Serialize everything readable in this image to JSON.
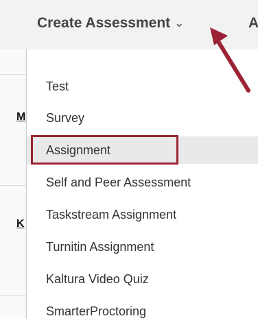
{
  "toolbar": {
    "create_assessment_label": "Create Assessment",
    "next_item_fragment": "A"
  },
  "left_fragments": [
    "M",
    "K"
  ],
  "menu": {
    "items": [
      {
        "label": "Test"
      },
      {
        "label": "Survey"
      },
      {
        "label": "Assignment",
        "highlighted": true
      },
      {
        "label": "Self and Peer Assessment"
      },
      {
        "label": "Taskstream Assignment"
      },
      {
        "label": "Turnitin Assignment"
      },
      {
        "label": "Kaltura Video Quiz"
      },
      {
        "label": "SmarterProctoring"
      }
    ]
  },
  "colors": {
    "highlight_border": "#9b2335",
    "arrow": "#9b2335",
    "toolbar_bg": "#f2f2f2",
    "selected_item_bg": "#e9e9e9"
  },
  "icons": {
    "dropdown_chevron": "chevron-down-icon",
    "annotation_arrow": "arrow-icon"
  }
}
